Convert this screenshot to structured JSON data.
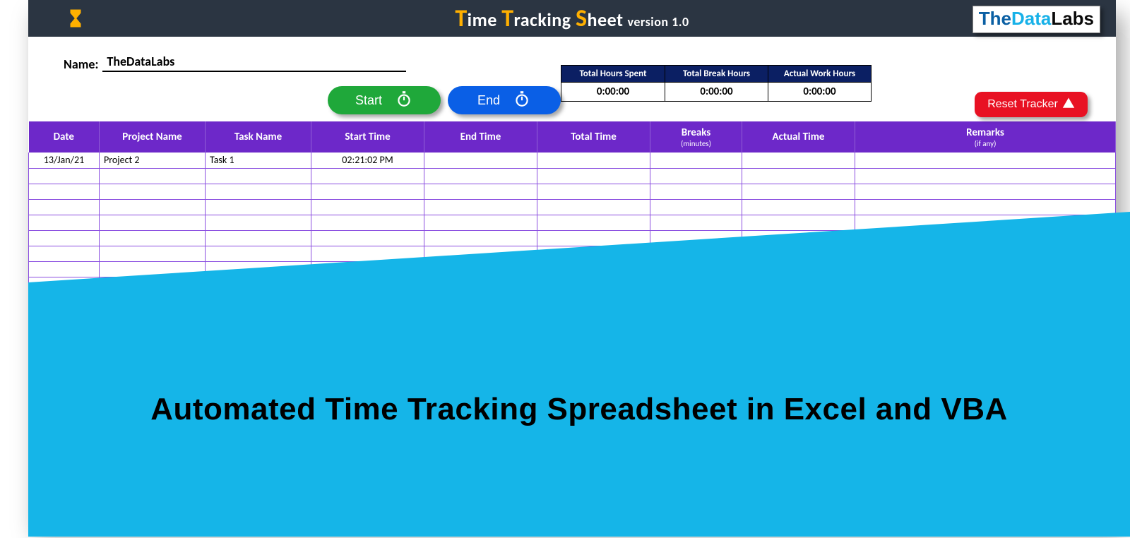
{
  "header": {
    "title_parts": {
      "t": "T",
      "ime": "ime ",
      "t2": "T",
      "racking": "racking ",
      "s": "S",
      "heet": "heet",
      "ver": "version 1.0"
    },
    "logo_parts": {
      "a": "The",
      "b": "Data",
      "c": "Labs"
    }
  },
  "name": {
    "label": "Name:",
    "value": "TheDataLabs"
  },
  "buttons": {
    "start": "Start",
    "end": "End",
    "reset": "Reset Tracker"
  },
  "summary": {
    "cols": [
      {
        "header": "Total Hours Spent",
        "value": "0:00:00"
      },
      {
        "header": "Total Break Hours",
        "value": "0:00:00"
      },
      {
        "header": "Actual Work Hours",
        "value": "0:00:00"
      }
    ]
  },
  "columns": {
    "date": "Date",
    "project": "Project Name",
    "task": "Task Name",
    "start": "Start Time",
    "end": "End Time",
    "total": "Total Time",
    "breaks": "Breaks",
    "breaks_sub": "(minutes)",
    "actual": "Actual Time",
    "remarks": "Remarks",
    "remarks_sub": "(if any)"
  },
  "rows": [
    {
      "date": "13/Jan/21",
      "project": "Project 2",
      "task": "Task 1",
      "start": "02:21:02 PM",
      "end": "",
      "total": "",
      "breaks": "",
      "actual": "",
      "remarks": ""
    },
    {
      "date": "",
      "project": "",
      "task": "",
      "start": "",
      "end": "",
      "total": "",
      "breaks": "",
      "actual": "",
      "remarks": ""
    },
    {
      "date": "",
      "project": "",
      "task": "",
      "start": "",
      "end": "",
      "total": "",
      "breaks": "",
      "actual": "",
      "remarks": ""
    },
    {
      "date": "",
      "project": "",
      "task": "",
      "start": "",
      "end": "",
      "total": "",
      "breaks": "",
      "actual": "",
      "remarks": ""
    },
    {
      "date": "",
      "project": "",
      "task": "",
      "start": "",
      "end": "",
      "total": "",
      "breaks": "",
      "actual": "",
      "remarks": ""
    },
    {
      "date": "",
      "project": "",
      "task": "",
      "start": "",
      "end": "",
      "total": "",
      "breaks": "",
      "actual": "",
      "remarks": ""
    },
    {
      "date": "",
      "project": "",
      "task": "",
      "start": "",
      "end": "",
      "total": "",
      "breaks": "",
      "actual": "",
      "remarks": ""
    },
    {
      "date": "",
      "project": "",
      "task": "",
      "start": "",
      "end": "",
      "total": "",
      "breaks": "",
      "actual": "",
      "remarks": ""
    },
    {
      "date": "",
      "project": "",
      "task": "",
      "start": "",
      "end": "",
      "total": "",
      "breaks": "",
      "actual": "",
      "remarks": ""
    }
  ],
  "overlay": {
    "headline": "Automated Time Tracking Spreadsheet in Excel and VBA"
  }
}
